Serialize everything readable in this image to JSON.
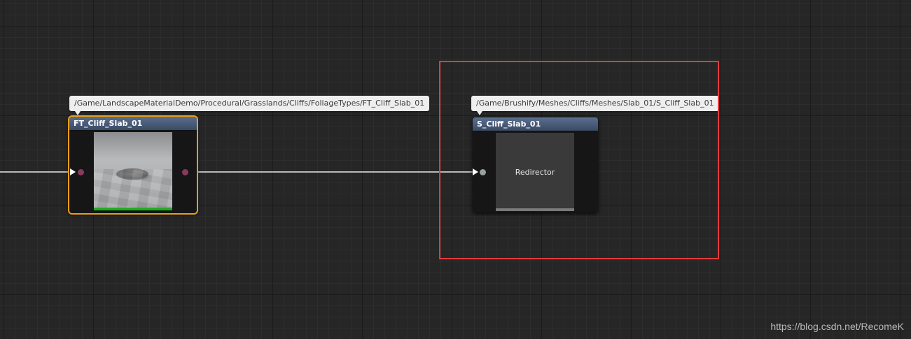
{
  "colors": {
    "background": "#262626",
    "selection_outline": "#e8a015",
    "title_bar": "#4a5d7c",
    "annotation_box": "#e23b3b",
    "wire": "#ffffff",
    "status_bar_green": "#1fae1f",
    "pin_foliage": "#8a3a5c",
    "pin_mesh": "#9aa09a"
  },
  "tooltips": {
    "left_path": "/Game/LandscapeMaterialDemo/Procedural/Grasslands/Cliffs/FoliageTypes/FT_Cliff_Slab_01",
    "right_path": "/Game/Brushify/Meshes/Cliffs/Meshes/Slab_01/S_Cliff_Slab_01"
  },
  "nodes": {
    "foliage": {
      "title": "FT_Cliff_Slab_01",
      "selected": true,
      "thumbnail": "rock-mesh-preview"
    },
    "mesh": {
      "title": "S_Cliff_Slab_01",
      "selected": false,
      "thumbnail_label": "Redirector"
    }
  },
  "watermark": "https://blog.csdn.net/RecomeK"
}
